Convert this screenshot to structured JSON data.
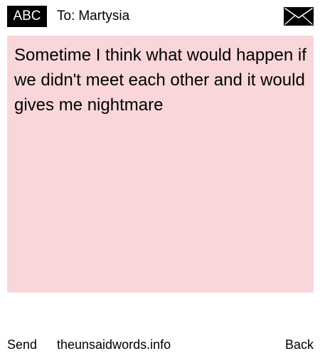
{
  "header": {
    "badge_label": "ABC",
    "to_prefix": "To:",
    "recipient_name": "Martysia",
    "icon": "envelope-icon"
  },
  "message": {
    "text": "Sometime I think what would happen if we didn't meet each other and it would gives me nightmare",
    "background_color": "#f9d6da"
  },
  "footer": {
    "send_label": "Send",
    "site_label": "theunsaidwords.info",
    "back_label": "Back"
  }
}
